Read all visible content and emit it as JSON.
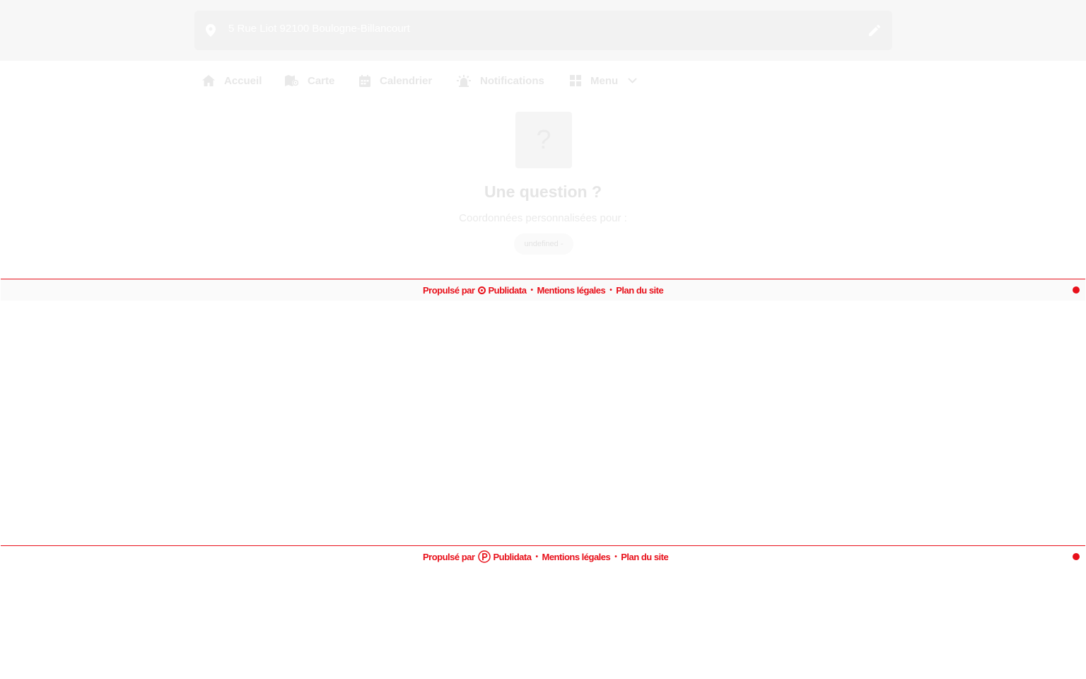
{
  "header": {
    "address": "5 Rue Liot 92100 Boulogne-Billancourt",
    "icons": {
      "location": "map-pin-icon",
      "edit": "pencil-icon"
    }
  },
  "nav": {
    "items": [
      {
        "label": "Accueil",
        "icon": "home-icon"
      },
      {
        "label": "Carte",
        "icon": "map-icon"
      },
      {
        "label": "Calendrier",
        "icon": "calendar-icon"
      },
      {
        "label": "Notifications",
        "icon": "alarm-light-icon"
      },
      {
        "label": "Menu",
        "icon": "grid-icon"
      }
    ]
  },
  "main": {
    "placeholder_glyph": "?",
    "title": "Une question ?",
    "subtitle": "Coordonnées personnalisées pour :",
    "chip": "undefined -"
  },
  "footer": {
    "powered_by": "Propulsé par",
    "brand": "Publidata",
    "separator": "•",
    "legal": "Mentions légales",
    "sitemap": "Plan du site"
  },
  "colors": {
    "accent": "#e8101a",
    "header_bg": "#f7f7f7",
    "faded_text": "#e7e7e7"
  }
}
